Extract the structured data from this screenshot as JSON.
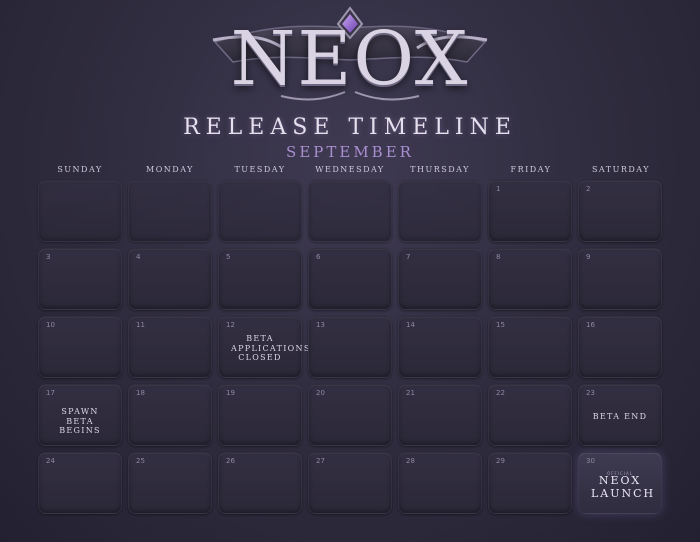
{
  "header": {
    "logo_text": "NEOX",
    "subtitle": "RELEASE TIMELINE",
    "month": "SEPTEMBER"
  },
  "weekdays": [
    "SUNDAY",
    "MONDAY",
    "TUESDAY",
    "WEDNESDAY",
    "THURSDAY",
    "FRIDAY",
    "SATURDAY"
  ],
  "days": {
    "d1": "1",
    "d2": "2",
    "d3": "3",
    "d4": "4",
    "d5": "5",
    "d6": "6",
    "d7": "7",
    "d8": "8",
    "d9": "9",
    "d10": "10",
    "d11": "11",
    "d12": "12",
    "d13": "13",
    "d14": "14",
    "d15": "15",
    "d16": "16",
    "d17": "17",
    "d18": "18",
    "d19": "19",
    "d20": "20",
    "d21": "21",
    "d22": "22",
    "d23": "23",
    "d24": "24",
    "d25": "25",
    "d26": "26",
    "d27": "27",
    "d28": "28",
    "d29": "29",
    "d30": "30"
  },
  "events": {
    "beta_applications": "BETA APPLICATIONS CLOSED",
    "spawn_beta": "SPAWN BETA BEGINS",
    "beta_end": "BETA END",
    "launch_small": "OFFICIAL",
    "launch_big": "NEOX LAUNCH"
  },
  "colors": {
    "accent": "#a98fd0",
    "gem": "#8b5cc9"
  }
}
